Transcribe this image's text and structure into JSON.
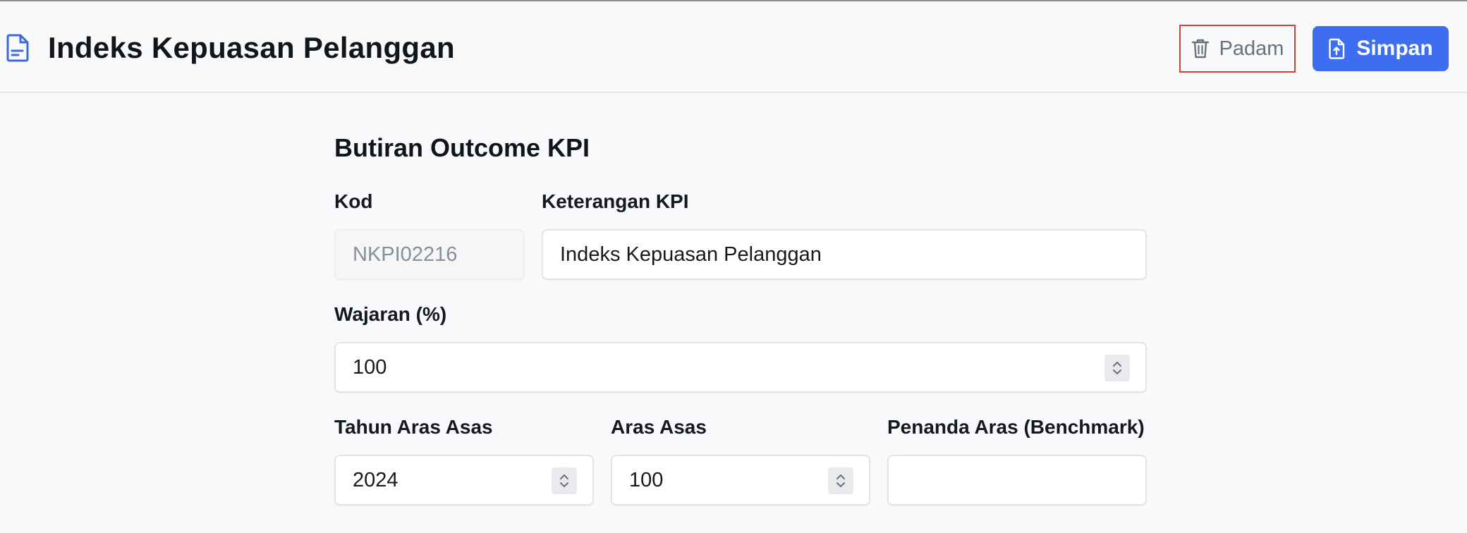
{
  "header": {
    "title": "Indeks Kepuasan Pelanggan",
    "delete_label": "Padam",
    "save_label": "Simpan"
  },
  "form": {
    "section_title": "Butiran Outcome KPI",
    "kod": {
      "label": "Kod",
      "value": "NKPI02216"
    },
    "keterangan": {
      "label": "Keterangan KPI",
      "value": "Indeks Kepuasan Pelanggan"
    },
    "wajaran": {
      "label": "Wajaran (%)",
      "value": "100"
    },
    "tahun_aras_asas": {
      "label": "Tahun Aras Asas",
      "value": "2024"
    },
    "aras_asas": {
      "label": "Aras Asas",
      "value": "100"
    },
    "penanda_aras": {
      "label": "Penanda Aras (Benchmark)",
      "value": ""
    }
  },
  "icons": {
    "title": "document-icon",
    "delete": "trash-icon",
    "save": "file-upload-icon",
    "stepper": "chevron-up-down-icon"
  },
  "colors": {
    "accent": "#3d6ef0",
    "delete_outline": "#d9402f",
    "icon_blue": "#3f68d8"
  }
}
